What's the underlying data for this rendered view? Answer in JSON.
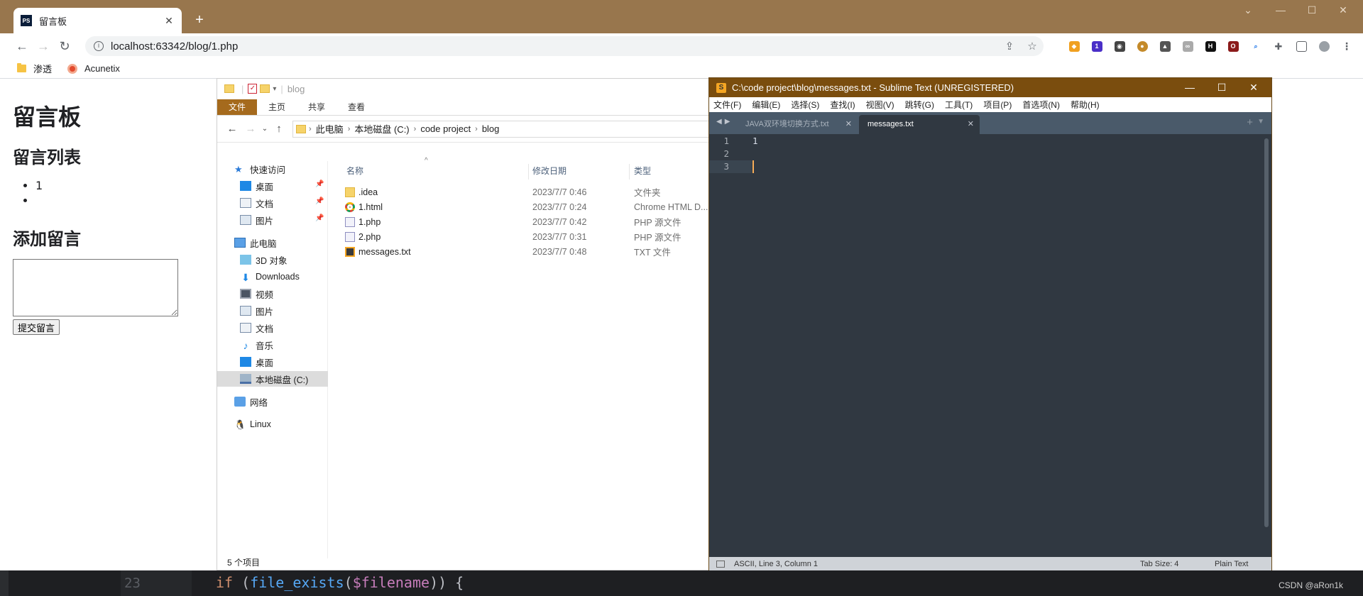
{
  "browser": {
    "tab_title": "留言板",
    "tab_icon": "PS",
    "new_tab": "+",
    "url": "localhost:63342/blog/1.php",
    "bookmarks": [
      "渗透",
      "Acunetix"
    ]
  },
  "page": {
    "h1": "留言板",
    "list_heading": "留言列表",
    "items": [
      "1",
      ""
    ],
    "add_heading": "添加留言",
    "submit_label": "提交留言"
  },
  "explorer": {
    "title": "blog",
    "ribbon_tabs": [
      "文件",
      "主页",
      "共享",
      "查看"
    ],
    "breadcrumb": [
      "此电脑",
      "本地磁盘 (C:)",
      "code project",
      "blog"
    ],
    "nav": {
      "quick_access": "快速访问",
      "desktop": "桌面",
      "documents": "文档",
      "pictures": "图片",
      "this_pc": "此电脑",
      "objects3d": "3D 对象",
      "downloads": "Downloads",
      "videos": "视频",
      "pictures2": "图片",
      "documents2": "文档",
      "music": "音乐",
      "desktop2": "桌面",
      "local_disk": "本地磁盘 (C:)",
      "network": "网络",
      "linux": "Linux"
    },
    "columns": {
      "name": "名称",
      "date": "修改日期",
      "type": "类型"
    },
    "files": [
      {
        "name": ".idea",
        "date": "2023/7/7 0:46",
        "type": "文件夹",
        "icon": "folder"
      },
      {
        "name": "1.html",
        "date": "2023/7/7 0:24",
        "type": "Chrome HTML D...",
        "icon": "chrome"
      },
      {
        "name": "1.php",
        "date": "2023/7/7 0:42",
        "type": "PHP 源文件",
        "icon": "php"
      },
      {
        "name": "2.php",
        "date": "2023/7/7 0:31",
        "type": "PHP 源文件",
        "icon": "php"
      },
      {
        "name": "messages.txt",
        "date": "2023/7/7 0:48",
        "type": "TXT 文件",
        "icon": "sublime"
      }
    ],
    "status": "5 个项目"
  },
  "sublime": {
    "title": "C:\\code project\\blog\\messages.txt - Sublime Text (UNREGISTERED)",
    "menu": [
      "文件(F)",
      "编辑(E)",
      "选择(S)",
      "查找(I)",
      "视图(V)",
      "跳转(G)",
      "工具(T)",
      "项目(P)",
      "首选项(N)",
      "帮助(H)"
    ],
    "tabs": [
      {
        "label": "JAVA双环境切换方式.txt",
        "active": false
      },
      {
        "label": "messages.txt",
        "active": true
      }
    ],
    "lines": [
      "1",
      "",
      ""
    ],
    "line_numbers": [
      "1",
      "2",
      "3"
    ],
    "status": {
      "position": "ASCII, Line 3, Column 1",
      "tab_size": "Tab Size: 4",
      "syntax": "Plain Text"
    }
  },
  "ide": {
    "line_number": "23",
    "code": {
      "kw": "if",
      "open": " (",
      "fn": "file_exists",
      "p1": "(",
      "var": "$filename",
      "p2": ")) {"
    }
  },
  "watermark": "CSDN @aRon1k",
  "colors": {
    "chrome_frame": "#98764d",
    "sublime_title": "#7a4d0e",
    "sublime_bg": "#303841",
    "explorer_file_tab": "#a56a1d"
  }
}
